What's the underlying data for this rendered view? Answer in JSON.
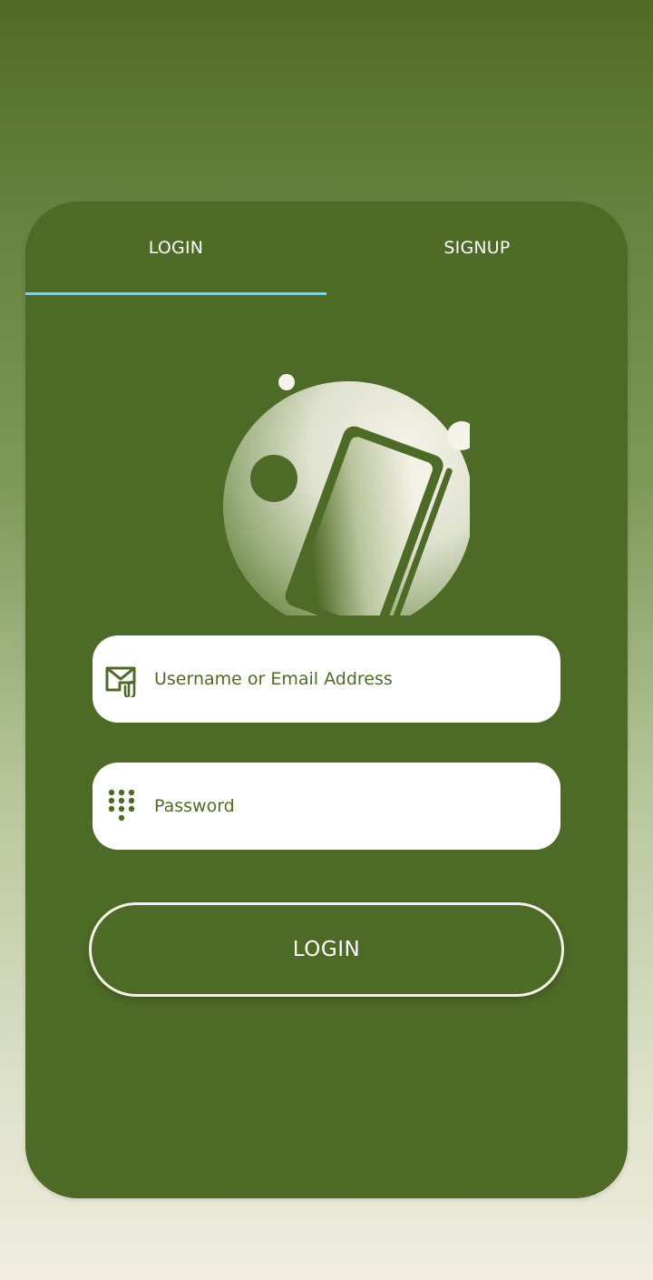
{
  "tabs": {
    "login_label": "LOGIN",
    "signup_label": "SIGNUP",
    "active": "login"
  },
  "form": {
    "username_placeholder": "Username or Email Address",
    "password_placeholder": "Password",
    "submit_label": "LOGIN"
  },
  "icons": {
    "illustration": "phone-illustration",
    "username": "mail-attachment-icon",
    "password": "keypad-icon"
  },
  "colors": {
    "card": "#4e6a27",
    "tab_indicator": "#7fd3d3",
    "field_bg": "#ffffff",
    "accent_text": "#4e6a27"
  }
}
